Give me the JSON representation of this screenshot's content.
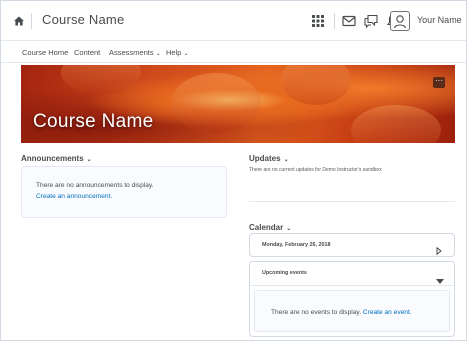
{
  "topbar": {
    "course_title": "Course Name",
    "user_name": "Your Name",
    "icons": [
      "home-icon",
      "grid-icon",
      "mail-icon",
      "chat-icon",
      "bell-icon",
      "user-icon"
    ]
  },
  "nav": {
    "items": [
      {
        "label": "Course Home",
        "has_menu": false
      },
      {
        "label": "Content",
        "has_menu": false
      },
      {
        "label": "Assessments",
        "has_menu": true
      },
      {
        "label": "Help",
        "has_menu": true
      }
    ],
    "chevron": "⌄"
  },
  "banner": {
    "title": "Course Name",
    "menu_glyph": "···"
  },
  "announcements": {
    "heading": "Announcements",
    "empty_text": "There are no announcements to display.",
    "create_link": "Create an announcement."
  },
  "updates": {
    "heading": "Updates",
    "text": "There are no current updates for Demo Instructor's sandbox"
  },
  "calendar": {
    "heading": "Calendar",
    "date": "Monday, February 26, 2018",
    "upcoming_label": "Upcoming events",
    "empty_text": "There are no events to display.",
    "create_link": "Create an event."
  },
  "colors": {
    "link": "#006fbf",
    "text": "#494c4e",
    "border": "#d3d9e3",
    "panel": "#f9fbff"
  }
}
